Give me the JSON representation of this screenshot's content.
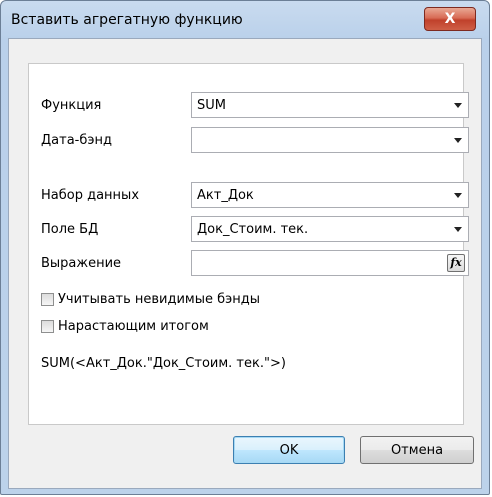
{
  "window": {
    "title": "Вставить агрегатную функцию",
    "close_label": "X"
  },
  "form": {
    "function": {
      "label": "Функция",
      "value": "SUM"
    },
    "databand": {
      "label": "Дата-бэнд",
      "value": ""
    },
    "dataset": {
      "label": "Набор данных",
      "value": "Акт_Док"
    },
    "db_field": {
      "label": "Поле БД",
      "value": "Док_Стоим. тек."
    },
    "expression": {
      "label": "Выражение",
      "value": "",
      "fx_label": "fx"
    },
    "include_invisible_bands": {
      "label": "Учитывать невидимые бэнды",
      "checked": false
    },
    "running_total": {
      "label": "Нарастающим итогом",
      "checked": false
    },
    "formula_preview": "SUM(<Акт_Док.\"Док_Стоим. тек.\">)"
  },
  "buttons": {
    "ok": "OK",
    "cancel": "Отмена"
  }
}
